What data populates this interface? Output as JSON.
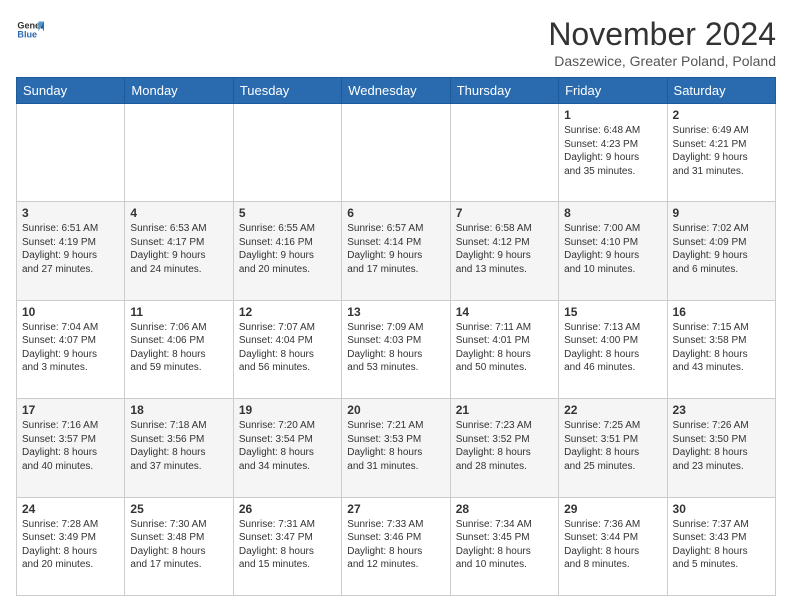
{
  "logo": {
    "line1": "General",
    "line2": "Blue"
  },
  "title": "November 2024",
  "location": "Daszewice, Greater Poland, Poland",
  "weekdays": [
    "Sunday",
    "Monday",
    "Tuesday",
    "Wednesday",
    "Thursday",
    "Friday",
    "Saturday"
  ],
  "weeks": [
    [
      {
        "day": "",
        "info": ""
      },
      {
        "day": "",
        "info": ""
      },
      {
        "day": "",
        "info": ""
      },
      {
        "day": "",
        "info": ""
      },
      {
        "day": "",
        "info": ""
      },
      {
        "day": "1",
        "info": "Sunrise: 6:48 AM\nSunset: 4:23 PM\nDaylight: 9 hours\nand 35 minutes."
      },
      {
        "day": "2",
        "info": "Sunrise: 6:49 AM\nSunset: 4:21 PM\nDaylight: 9 hours\nand 31 minutes."
      }
    ],
    [
      {
        "day": "3",
        "info": "Sunrise: 6:51 AM\nSunset: 4:19 PM\nDaylight: 9 hours\nand 27 minutes."
      },
      {
        "day": "4",
        "info": "Sunrise: 6:53 AM\nSunset: 4:17 PM\nDaylight: 9 hours\nand 24 minutes."
      },
      {
        "day": "5",
        "info": "Sunrise: 6:55 AM\nSunset: 4:16 PM\nDaylight: 9 hours\nand 20 minutes."
      },
      {
        "day": "6",
        "info": "Sunrise: 6:57 AM\nSunset: 4:14 PM\nDaylight: 9 hours\nand 17 minutes."
      },
      {
        "day": "7",
        "info": "Sunrise: 6:58 AM\nSunset: 4:12 PM\nDaylight: 9 hours\nand 13 minutes."
      },
      {
        "day": "8",
        "info": "Sunrise: 7:00 AM\nSunset: 4:10 PM\nDaylight: 9 hours\nand 10 minutes."
      },
      {
        "day": "9",
        "info": "Sunrise: 7:02 AM\nSunset: 4:09 PM\nDaylight: 9 hours\nand 6 minutes."
      }
    ],
    [
      {
        "day": "10",
        "info": "Sunrise: 7:04 AM\nSunset: 4:07 PM\nDaylight: 9 hours\nand 3 minutes."
      },
      {
        "day": "11",
        "info": "Sunrise: 7:06 AM\nSunset: 4:06 PM\nDaylight: 8 hours\nand 59 minutes."
      },
      {
        "day": "12",
        "info": "Sunrise: 7:07 AM\nSunset: 4:04 PM\nDaylight: 8 hours\nand 56 minutes."
      },
      {
        "day": "13",
        "info": "Sunrise: 7:09 AM\nSunset: 4:03 PM\nDaylight: 8 hours\nand 53 minutes."
      },
      {
        "day": "14",
        "info": "Sunrise: 7:11 AM\nSunset: 4:01 PM\nDaylight: 8 hours\nand 50 minutes."
      },
      {
        "day": "15",
        "info": "Sunrise: 7:13 AM\nSunset: 4:00 PM\nDaylight: 8 hours\nand 46 minutes."
      },
      {
        "day": "16",
        "info": "Sunrise: 7:15 AM\nSunset: 3:58 PM\nDaylight: 8 hours\nand 43 minutes."
      }
    ],
    [
      {
        "day": "17",
        "info": "Sunrise: 7:16 AM\nSunset: 3:57 PM\nDaylight: 8 hours\nand 40 minutes."
      },
      {
        "day": "18",
        "info": "Sunrise: 7:18 AM\nSunset: 3:56 PM\nDaylight: 8 hours\nand 37 minutes."
      },
      {
        "day": "19",
        "info": "Sunrise: 7:20 AM\nSunset: 3:54 PM\nDaylight: 8 hours\nand 34 minutes."
      },
      {
        "day": "20",
        "info": "Sunrise: 7:21 AM\nSunset: 3:53 PM\nDaylight: 8 hours\nand 31 minutes."
      },
      {
        "day": "21",
        "info": "Sunrise: 7:23 AM\nSunset: 3:52 PM\nDaylight: 8 hours\nand 28 minutes."
      },
      {
        "day": "22",
        "info": "Sunrise: 7:25 AM\nSunset: 3:51 PM\nDaylight: 8 hours\nand 25 minutes."
      },
      {
        "day": "23",
        "info": "Sunrise: 7:26 AM\nSunset: 3:50 PM\nDaylight: 8 hours\nand 23 minutes."
      }
    ],
    [
      {
        "day": "24",
        "info": "Sunrise: 7:28 AM\nSunset: 3:49 PM\nDaylight: 8 hours\nand 20 minutes."
      },
      {
        "day": "25",
        "info": "Sunrise: 7:30 AM\nSunset: 3:48 PM\nDaylight: 8 hours\nand 17 minutes."
      },
      {
        "day": "26",
        "info": "Sunrise: 7:31 AM\nSunset: 3:47 PM\nDaylight: 8 hours\nand 15 minutes."
      },
      {
        "day": "27",
        "info": "Sunrise: 7:33 AM\nSunset: 3:46 PM\nDaylight: 8 hours\nand 12 minutes."
      },
      {
        "day": "28",
        "info": "Sunrise: 7:34 AM\nSunset: 3:45 PM\nDaylight: 8 hours\nand 10 minutes."
      },
      {
        "day": "29",
        "info": "Sunrise: 7:36 AM\nSunset: 3:44 PM\nDaylight: 8 hours\nand 8 minutes."
      },
      {
        "day": "30",
        "info": "Sunrise: 7:37 AM\nSunset: 3:43 PM\nDaylight: 8 hours\nand 5 minutes."
      }
    ]
  ]
}
